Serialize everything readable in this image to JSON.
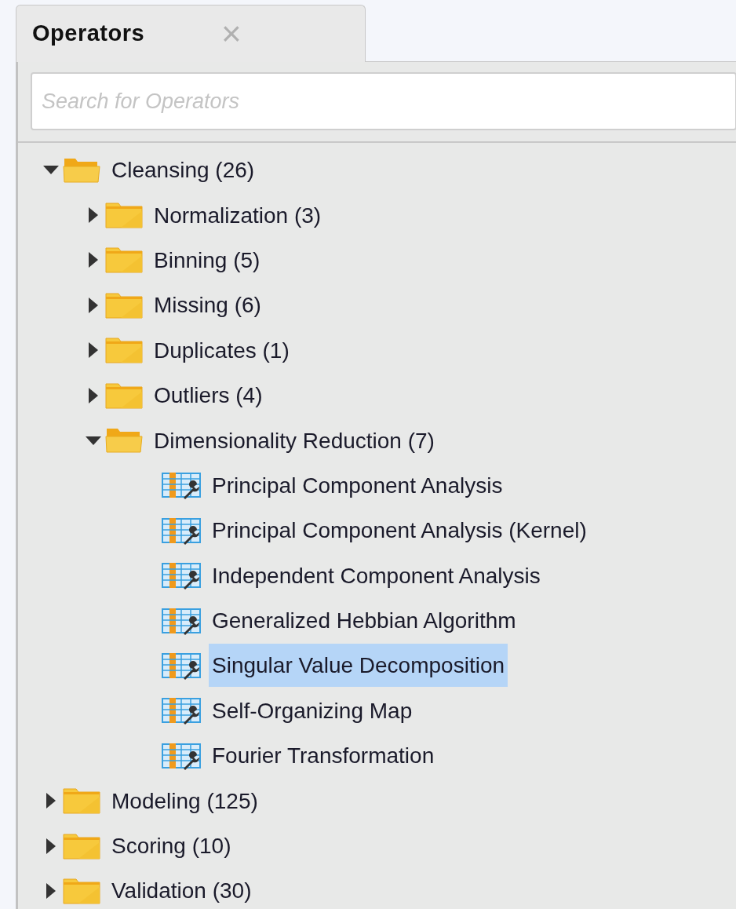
{
  "tab": {
    "label": "Operators",
    "close": "×",
    "selected": true
  },
  "search": {
    "placeholder": "Search for Operators"
  },
  "tree": [
    {
      "kind": "folder",
      "label": "Cleansing (26)",
      "expanded": true,
      "selected": false,
      "children": [
        {
          "kind": "folder",
          "label": "Normalization (3)",
          "expanded": false,
          "selected": false
        },
        {
          "kind": "folder",
          "label": "Binning (5)",
          "expanded": false,
          "selected": false
        },
        {
          "kind": "folder",
          "label": "Missing (6)",
          "expanded": false,
          "selected": false
        },
        {
          "kind": "folder",
          "label": "Duplicates (1)",
          "expanded": false,
          "selected": false
        },
        {
          "kind": "folder",
          "label": "Outliers (4)",
          "expanded": false,
          "selected": false
        },
        {
          "kind": "folder",
          "label": "Dimensionality Reduction (7)",
          "expanded": true,
          "selected": false,
          "children": [
            {
              "kind": "operator",
              "label": "Principal Component Analysis",
              "selected": false
            },
            {
              "kind": "operator",
              "label": "Principal Component Analysis (Kernel)",
              "selected": false
            },
            {
              "kind": "operator",
              "label": "Independent Component Analysis",
              "selected": false
            },
            {
              "kind": "operator",
              "label": "Generalized Hebbian Algorithm",
              "selected": false
            },
            {
              "kind": "operator",
              "label": "Singular Value Decomposition",
              "selected": true
            },
            {
              "kind": "operator",
              "label": "Self-Organizing Map",
              "selected": false
            },
            {
              "kind": "operator",
              "label": "Fourier Transformation",
              "selected": false
            }
          ]
        }
      ]
    },
    {
      "kind": "folder",
      "label": "Modeling (125)",
      "expanded": false,
      "selected": false
    },
    {
      "kind": "folder",
      "label": "Scoring (10)",
      "expanded": false,
      "selected": false
    },
    {
      "kind": "folder",
      "label": "Validation (30)",
      "expanded": false,
      "selected": false
    }
  ]
}
